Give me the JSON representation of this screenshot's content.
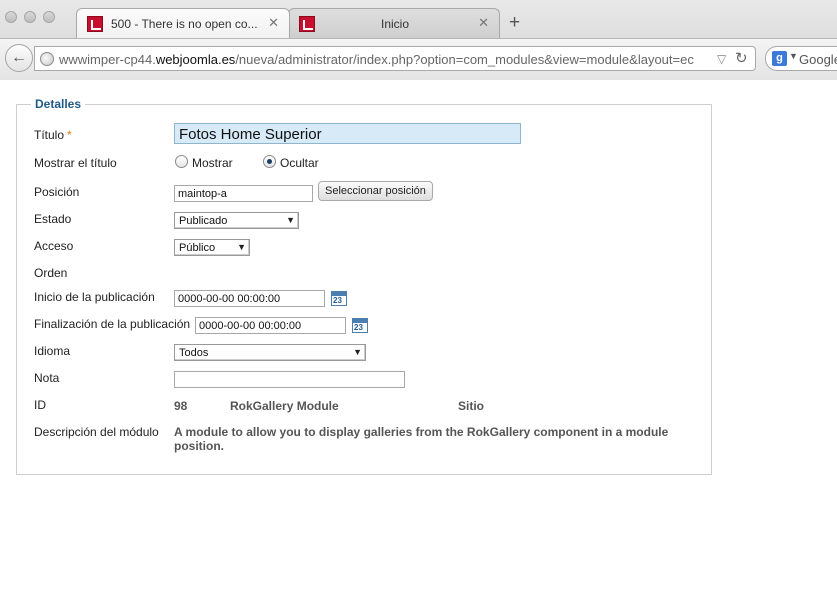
{
  "browser": {
    "tabs": [
      {
        "label": "500 - There is no open co...",
        "active": true
      },
      {
        "label": "Inicio",
        "active": false
      }
    ],
    "url_prefix": "wwwimper-cp44.",
    "url_domain": "webjoomla.es",
    "url_path": "/nueva/administrator/index.php?option=com_modules&view=module&layout=ec",
    "search_engine": "Google",
    "new_tab": "+",
    "close_glyph": "✕"
  },
  "form": {
    "legend": "Detalles",
    "title_label": "Título",
    "required_mark": "*",
    "title_value": "Fotos Home Superior",
    "show_title_label": "Mostrar el título",
    "show_option": "Mostrar",
    "hide_option": "Ocultar",
    "show_title_selected": "Ocultar",
    "position_label": "Posición",
    "position_value": "maintop-a",
    "select_position_button": "Seleccionar posición",
    "state_label": "Estado",
    "state_value": "Publicado",
    "access_label": "Acceso",
    "access_value": "Público",
    "order_label": "Orden",
    "publish_up_label": "Inicio de la publicación",
    "publish_up_value": "0000-00-00 00:00:00",
    "publish_down_label": "Finalización de la publicación",
    "publish_down_value": "0000-00-00 00:00:00",
    "calendar_day": "23",
    "language_label": "Idioma",
    "language_value": "Todos",
    "note_label": "Nota",
    "note_value": "",
    "id_label": "ID",
    "id_value": "98",
    "module_name": "RokGallery Module",
    "client": "Sitio",
    "description_label": "Descripción del módulo",
    "description_value": "A module to allow you to display galleries from the RokGallery component in a module position."
  },
  "colors": {
    "legend": "#205a87",
    "title_input_bg": "#d6eaf8",
    "required": "#e07b13"
  }
}
